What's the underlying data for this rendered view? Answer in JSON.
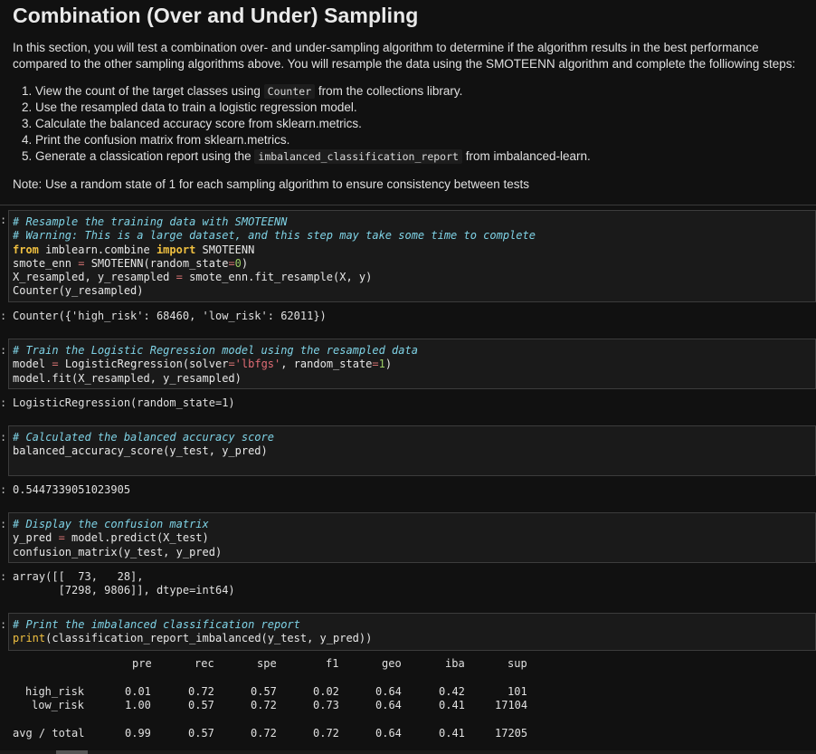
{
  "heading": "Combination (Over and Under) Sampling",
  "intro": "In this section, you will test a combination over- and under-sampling algorithm to determine if the algorithm results in the best performance compared to the other sampling algorithms above. You will resample the data using the SMOTEENN algorithm and complete the folliowing steps:",
  "steps": [
    {
      "pre": "View the count of the target classes using ",
      "code": "Counter",
      "post": " from the collections library."
    },
    {
      "pre": "Use the resampled data to train a logistic regression model.",
      "code": "",
      "post": ""
    },
    {
      "pre": "Calculate the balanced accuracy score from sklearn.metrics.",
      "code": "",
      "post": ""
    },
    {
      "pre": "Print the confusion matrix from sklearn.metrics.",
      "code": "",
      "post": ""
    },
    {
      "pre": "Generate a classication report using the ",
      "code": "imbalanced_classification_report",
      "post": " from imbalanced-learn."
    }
  ],
  "note": "Note: Use a random state of 1 for each sampling algorithm to ensure consistency between tests",
  "prompt_char": ":",
  "cells": {
    "resample": {
      "c1": "# Resample the training data with SMOTEENN",
      "c2": "# Warning: This is a large dataset, and this step may take some time to complete",
      "l3_kw1": "from",
      "l3_mod": " imblearn.combine ",
      "l3_kw2": "import",
      "l3_rest": " SMOTEENN",
      "l4_a": "smote_enn ",
      "l4_eq": "=",
      "l4_b": " SMOTEENN(random_state",
      "l4_eq2": "=",
      "l4_num": "0",
      "l4_c": ")",
      "l5_a": "X_resampled, y_resampled ",
      "l5_eq": "=",
      "l5_b": " smote_enn.fit_resample(X, y)",
      "l6": "Counter(y_resampled)",
      "output": "Counter({'high_risk': 68460, 'low_risk': 62011})"
    },
    "train": {
      "c1": "# Train the Logistic Regression model using the resampled data",
      "l2_a": "model ",
      "l2_eq": "=",
      "l2_b": " LogisticRegression(solver",
      "l2_eq2": "=",
      "l2_str": "'lbfgs'",
      "l2_c": ", random_state",
      "l2_eq3": "=",
      "l2_num": "1",
      "l2_d": ")",
      "l3": "model.fit(X_resampled, y_resampled)",
      "output": "LogisticRegression(random_state=1)"
    },
    "accuracy": {
      "c1": "# Calculated the balanced accuracy score",
      "l2": "balanced_accuracy_score(y_test, y_pred)",
      "output": "0.5447339051023905"
    },
    "confusion": {
      "c1": "# Display the confusion matrix",
      "l2_a": "y_pred ",
      "l2_eq": "=",
      "l2_b": " model.predict(X_test)",
      "l3": "confusion_matrix(y_test, y_pred)",
      "output": "array([[  73,   28],\n       [7298, 9806]], dtype=int64)"
    },
    "report": {
      "c1": "# Print the imbalanced classification report",
      "l2_fn": "print",
      "l2_rest": "(classification_report_imbalanced(y_test, y_pred))"
    }
  },
  "report_table": {
    "headers": [
      "pre",
      "rec",
      "spe",
      "f1",
      "geo",
      "iba",
      "sup"
    ],
    "rows": [
      {
        "label": "high_risk",
        "values": [
          "0.01",
          "0.72",
          "0.57",
          "0.02",
          "0.64",
          "0.42",
          "101"
        ]
      },
      {
        "label": "low_risk",
        "values": [
          "1.00",
          "0.57",
          "0.72",
          "0.73",
          "0.64",
          "0.41",
          "17104"
        ]
      },
      {
        "label": "avg / total",
        "values": [
          "0.99",
          "0.57",
          "0.72",
          "0.72",
          "0.64",
          "0.41",
          "17205"
        ]
      }
    ]
  }
}
